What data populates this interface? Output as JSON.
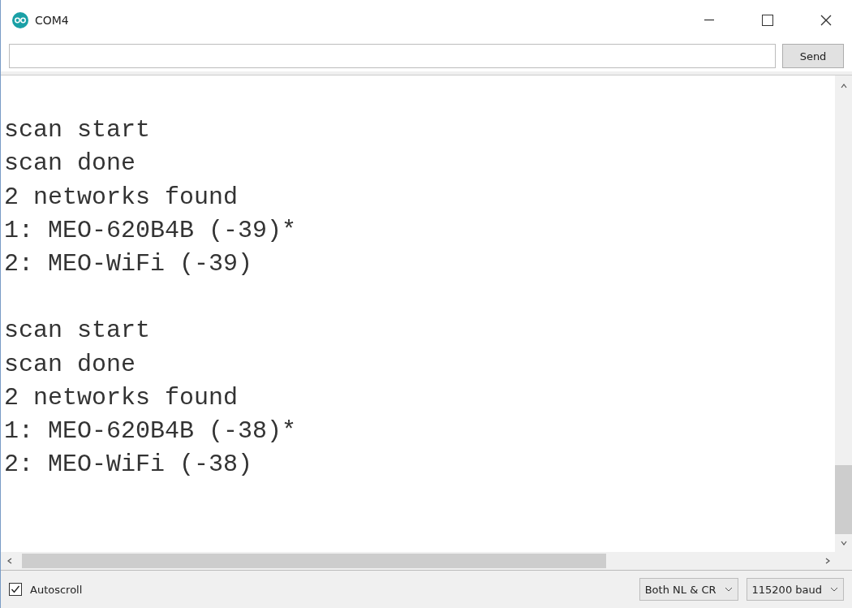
{
  "window": {
    "title": "COM4"
  },
  "send_bar": {
    "button": "Send"
  },
  "output": [
    {
      "lines": [
        "scan start",
        "scan done",
        "2 networks found",
        "1: MEO-620B4B (-39)*",
        "2: MEO-WiFi (-39)"
      ]
    },
    {
      "lines": [
        "scan start",
        "scan done",
        "2 networks found",
        "1: MEO-620B4B (-38)*",
        "2: MEO-WiFi (-38)"
      ]
    }
  ],
  "status_bar": {
    "autoscroll": {
      "label": "Autoscroll",
      "checked": true
    },
    "line_ending": "Both NL & CR",
    "baud": "115200 baud"
  }
}
